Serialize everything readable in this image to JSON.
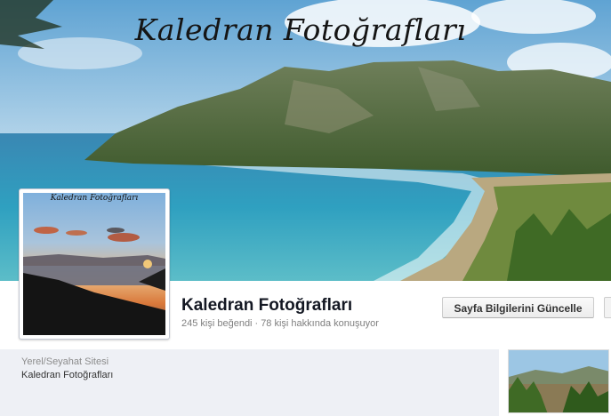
{
  "cover": {
    "title": "Kaledran Fotoğrafları"
  },
  "profile": {
    "caption": "Kaledran Fotoğrafları"
  },
  "page": {
    "name": "Kaledran Fotoğrafları",
    "likes": "245 kişi beğendi",
    "talking": "78 kişi hakkında konuşuyor"
  },
  "actions": {
    "update_info": "Sayfa Bilgilerini Güncelle"
  },
  "about": {
    "category": "Yerel/Seyahat Sitesi",
    "name": "Kaledran Fotoğrafları"
  },
  "colors": {
    "sky": "#8ab9dd",
    "sea": "#2e93b7",
    "mountain": "#566e3f",
    "panel": "#eef0f5"
  }
}
